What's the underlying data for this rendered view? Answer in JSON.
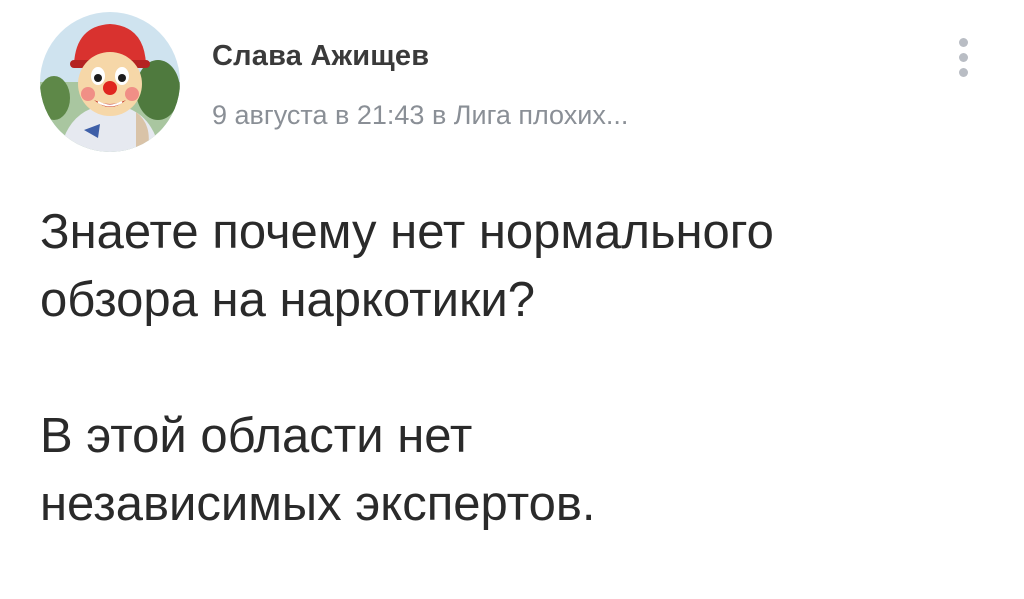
{
  "post": {
    "author": {
      "name": "Слава Ажищев",
      "avatar_icon": "clown-avatar-icon"
    },
    "meta": {
      "date": "9 августа в 21:43",
      "in_word": "в",
      "group": "Лига плохих..."
    },
    "more_icon": "vertical-dots-icon",
    "text": {
      "paragraphs": [
        {
          "lines": [
            "Знаете почему нет нормального",
            "обзора на наркотики?"
          ]
        },
        {
          "lines": [
            "В этой области нет",
            "независимых экспертов."
          ]
        }
      ]
    }
  },
  "colors": {
    "text": "#2a2a2a",
    "author": "#3a3a3a",
    "meta": "#8a8f96",
    "dots": "#b9bdc4",
    "background": "#ffffff"
  }
}
